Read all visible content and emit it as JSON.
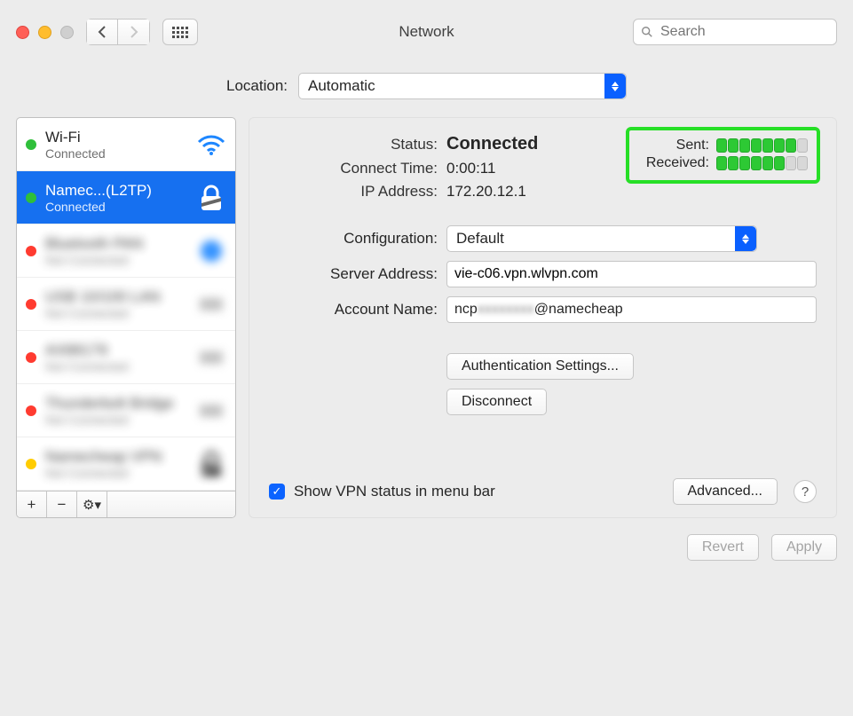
{
  "window": {
    "title": "Network",
    "search_placeholder": "Search"
  },
  "location": {
    "label": "Location:",
    "value": "Automatic"
  },
  "sidebar": {
    "items": [
      {
        "name": "Wi-Fi",
        "sub": "Connected",
        "dot": "green",
        "icon": "wifi"
      },
      {
        "name": "Namec...(L2TP)",
        "sub": "Connected",
        "dot": "green",
        "icon": "lock",
        "selected": true
      },
      {
        "name": "Bluetooth PAN",
        "sub": "Not Connected",
        "dot": "red",
        "icon": "bt",
        "blurred": true
      },
      {
        "name": "USB 10/100 LAN",
        "sub": "Not Connected",
        "dot": "red",
        "icon": "eth",
        "blurred": true
      },
      {
        "name": "AX88179",
        "sub": "Not Connected",
        "dot": "red",
        "icon": "eth",
        "blurred": true
      },
      {
        "name": "Thunderbolt Bridge",
        "sub": "Not Connected",
        "dot": "red",
        "icon": "eth",
        "blurred": true
      },
      {
        "name": "Namecheap VPN",
        "sub": "Not Connected",
        "dot": "amber",
        "icon": "lock",
        "blurred": true
      }
    ],
    "buttons": {
      "add": "+",
      "remove": "−",
      "gear": "⚙︎▾"
    }
  },
  "detail": {
    "status_label": "Status:",
    "status_value": "Connected",
    "connect_time_label": "Connect Time:",
    "connect_time_value": "0:00:11",
    "ip_label": "IP Address:",
    "ip_value": "172.20.12.1",
    "sent_label": "Sent:",
    "received_label": "Received:",
    "sent_bars": 7,
    "received_bars": 6,
    "bar_total": 8,
    "config_label": "Configuration:",
    "config_value": "Default",
    "server_label": "Server Address:",
    "server_value": "vie-c06.vpn.wlvpn.com",
    "account_label": "Account Name:",
    "account_prefix": "ncp",
    "account_mid": "xxxxxxxx",
    "account_suffix": "@namecheap",
    "auth_btn": "Authentication Settings...",
    "disconnect_btn": "Disconnect",
    "show_vpn_label": "Show VPN status in menu bar",
    "advanced_btn": "Advanced..."
  },
  "footer": {
    "revert": "Revert",
    "apply": "Apply"
  }
}
